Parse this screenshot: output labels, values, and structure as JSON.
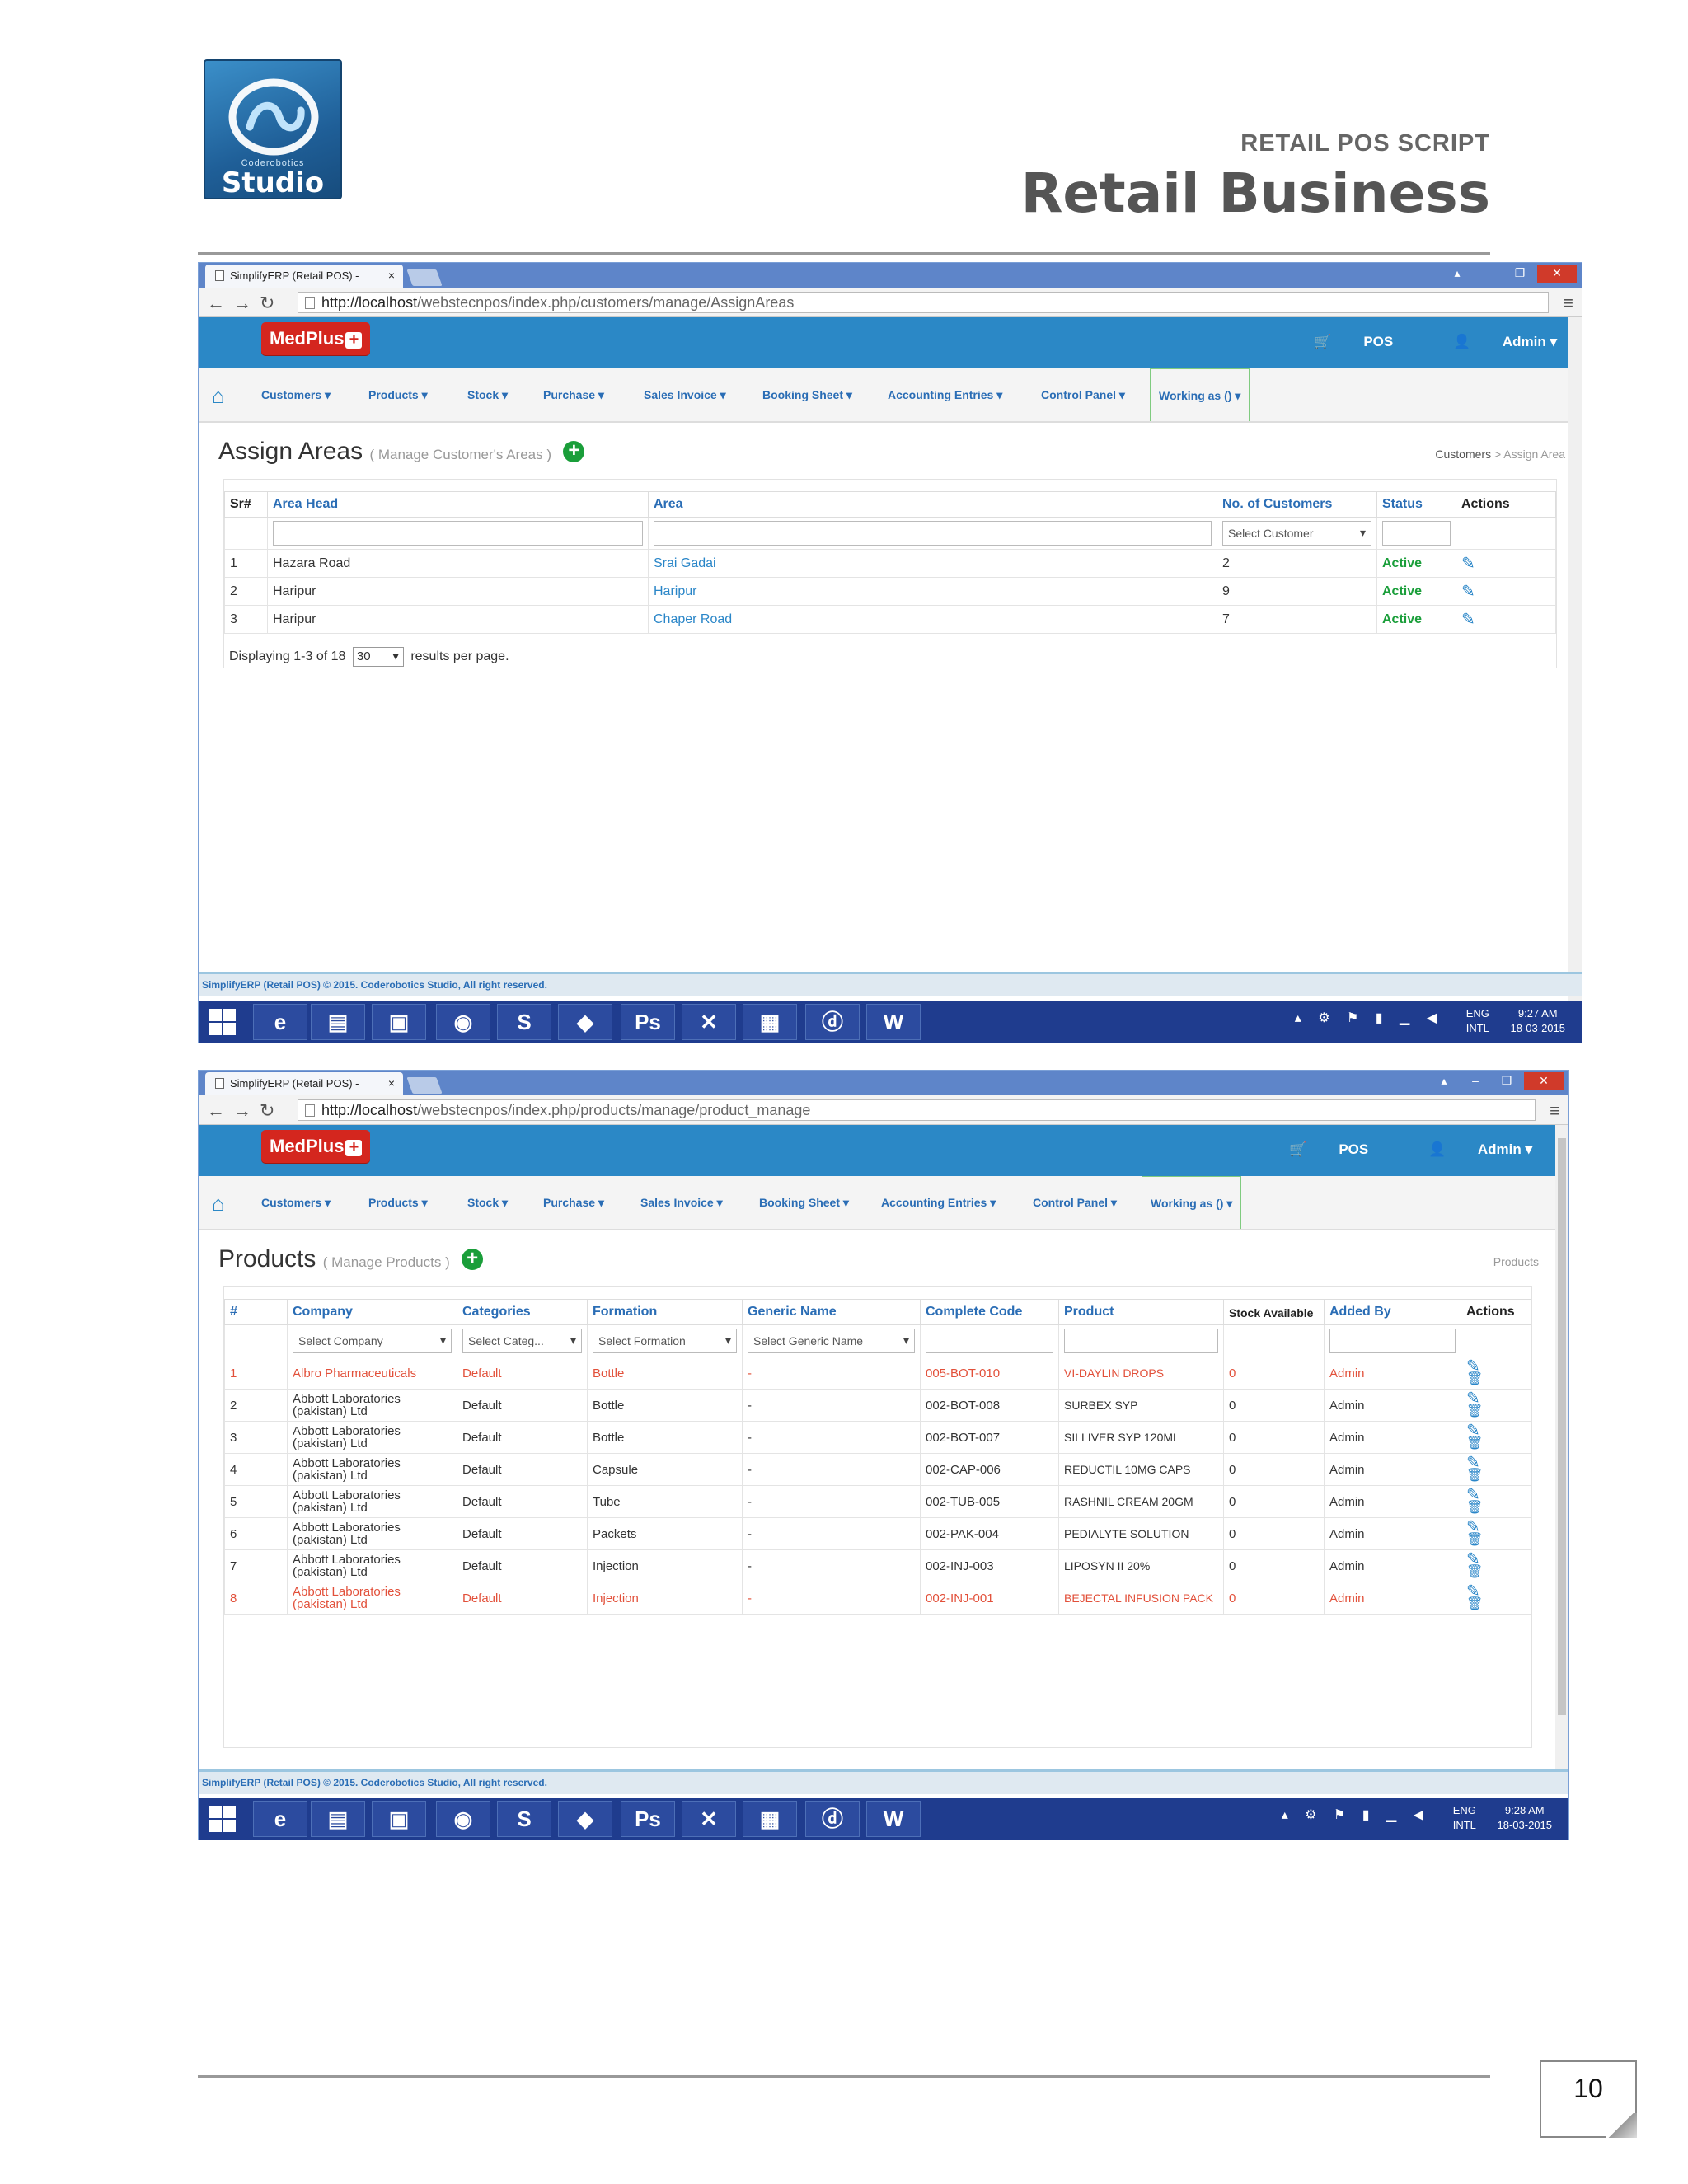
{
  "page": {
    "logo_small_text": "Coderobotics",
    "logo_big_text": "Studio",
    "subtitle": "RETAIL POS SCRIPT",
    "title": "Retail Business",
    "page_number": "10"
  },
  "browser": {
    "tab_title": "SimplifyERP (Retail POS) -",
    "app_brand": "MedPlus",
    "pos_label": "POS",
    "admin_label": "Admin ▾",
    "nav": [
      "Customers ▾",
      "Products ▾",
      "Stock ▾",
      "Purchase ▾",
      "Sales Invoice ▾",
      "Booking Sheet ▾",
      "Accounting Entries ▾",
      "Control Panel ▾"
    ],
    "working_as": "Working as () ▾",
    "footer_text": "SimplifyERP (Retail POS) © 2015. Coderobotics Studio, All right reserved.",
    "tray_lang_1": "ENG",
    "tray_lang_2": "INTL",
    "taskbar_icons": [
      "ie-icon",
      "explorer-icon",
      "store-icon",
      "chrome-icon",
      "skype-icon",
      "app-icon",
      "photoshop-icon",
      "tools-icon",
      "network-icon",
      "dreamweaver-icon",
      "word-icon"
    ]
  },
  "shot1": {
    "url_host": "http://localhost",
    "url_path": "/webstecnpos/index.php/customers/manage/AssignAreas",
    "page_title": "Assign Areas",
    "page_subtitle": "( Manage Customer's Areas )",
    "breadcrumb_1": "Customers",
    "breadcrumb_sep": ">",
    "breadcrumb_2": "Assign Area",
    "columns": [
      "Sr#",
      "Area Head",
      "Area",
      "No. of Customers",
      "Status",
      "Actions"
    ],
    "filter_customer_placeholder": "Select Customer",
    "rows": [
      {
        "sr": "1",
        "head": "Hazara Road",
        "area": "Srai Gadai",
        "count": "2",
        "status": "Active"
      },
      {
        "sr": "2",
        "head": "Haripur",
        "area": "Haripur",
        "count": "9",
        "status": "Active"
      },
      {
        "sr": "3",
        "head": "Haripur",
        "area": "Chaper Road",
        "count": "7",
        "status": "Active"
      }
    ],
    "pager_prefix": "Displaying 1-3 of 18",
    "pager_value": "30",
    "pager_suffix": "results per page.",
    "clock_time": "9:27 AM",
    "clock_date": "18-03-2015"
  },
  "shot2": {
    "url_host": "http://localhost",
    "url_path": "/webstecnpos/index.php/products/manage/product_manage",
    "page_title": "Products",
    "page_subtitle": "( Manage Products )",
    "breadcrumb": "Products",
    "columns": [
      "#",
      "Company",
      "Categories",
      "Formation",
      "Generic Name",
      "Complete Code",
      "Product",
      "Stock Available",
      "Added By",
      "Actions"
    ],
    "filters": {
      "company": "Select Company",
      "category": "Select Categ...",
      "formation": "Select Formation",
      "generic": "Select Generic Name"
    },
    "rows": [
      {
        "n": "1",
        "company": "Albro Pharmaceuticals",
        "cat": "Default",
        "form": "Bottle",
        "generic": "-",
        "code": "005-BOT-010",
        "product": "VI-DAYLIN DROPS",
        "stock": "0",
        "by": "Admin",
        "highlight": true
      },
      {
        "n": "2",
        "company": "Abbott Laboratories (pakistan) Ltd",
        "cat": "Default",
        "form": "Bottle",
        "generic": "-",
        "code": "002-BOT-008",
        "product": "SURBEX SYP",
        "stock": "0",
        "by": "Admin",
        "highlight": false
      },
      {
        "n": "3",
        "company": "Abbott Laboratories (pakistan) Ltd",
        "cat": "Default",
        "form": "Bottle",
        "generic": "-",
        "code": "002-BOT-007",
        "product": "SILLIVER SYP 120ML",
        "stock": "0",
        "by": "Admin",
        "highlight": false
      },
      {
        "n": "4",
        "company": "Abbott Laboratories (pakistan) Ltd",
        "cat": "Default",
        "form": "Capsule",
        "generic": "-",
        "code": "002-CAP-006",
        "product": "REDUCTIL 10MG CAPS",
        "stock": "0",
        "by": "Admin",
        "highlight": false
      },
      {
        "n": "5",
        "company": "Abbott Laboratories (pakistan) Ltd",
        "cat": "Default",
        "form": "Tube",
        "generic": "-",
        "code": "002-TUB-005",
        "product": "RASHNIL CREAM 20GM",
        "stock": "0",
        "by": "Admin",
        "highlight": false
      },
      {
        "n": "6",
        "company": "Abbott Laboratories (pakistan) Ltd",
        "cat": "Default",
        "form": "Packets",
        "generic": "-",
        "code": "002-PAK-004",
        "product": "PEDIALYTE SOLUTION",
        "stock": "0",
        "by": "Admin",
        "highlight": false
      },
      {
        "n": "7",
        "company": "Abbott Laboratories (pakistan) Ltd",
        "cat": "Default",
        "form": "Injection",
        "generic": "-",
        "code": "002-INJ-003",
        "product": "LIPOSYN II 20%",
        "stock": "0",
        "by": "Admin",
        "highlight": false
      },
      {
        "n": "8",
        "company": "Abbott Laboratories (pakistan) Ltd",
        "cat": "Default",
        "form": "Injection",
        "generic": "-",
        "code": "002-INJ-001",
        "product": "BEJECTAL INFUSION PACK",
        "stock": "0",
        "by": "Admin",
        "highlight": true
      }
    ],
    "clock_time": "9:28 AM",
    "clock_date": "18-03-2015"
  },
  "colors": {
    "appbar": "#2b88c6",
    "active": "#1a9e3a",
    "highlight_row": "#e2503a",
    "taskbar": "#1f3c8e"
  }
}
